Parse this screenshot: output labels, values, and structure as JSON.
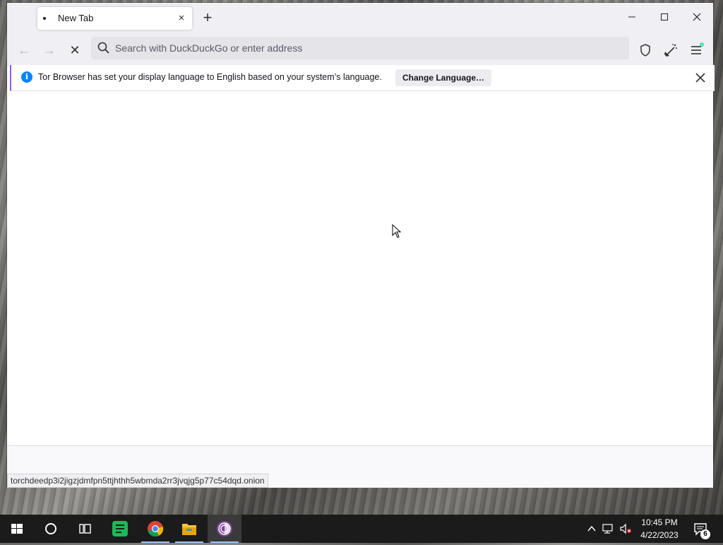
{
  "window": {
    "tab": {
      "title": "New Tab",
      "close_glyph": "×"
    },
    "newtab_glyph": "+",
    "controls": {
      "minimize": "—",
      "maximize": "☐",
      "close": "✕"
    }
  },
  "navbar": {
    "back_glyph": "←",
    "forward_glyph": "→",
    "stop_glyph": "✕",
    "url_placeholder": "Search with DuckDuckGo or enter address",
    "url_value": ""
  },
  "notification": {
    "message": "Tor Browser has set your display language to English based on your system’s language.",
    "button_label": "Change Language…",
    "accent_color": "#9059ff",
    "info_color": "#0a84ff"
  },
  "statuspanel": {
    "text": "torchdeedp3i2jigzjdmfpn5ttjhthh5wbmda2rr3jvqjg5p77c54dqd.onion"
  },
  "taskbar": {
    "apps": [
      "start-icon",
      "search-icon",
      "task-view-icon",
      "green-app-icon",
      "chrome-icon",
      "file-explorer-icon",
      "tor-browser-icon"
    ],
    "clock_time": "10:45 PM",
    "clock_date": "4/22/2023",
    "notification_count": "6"
  }
}
